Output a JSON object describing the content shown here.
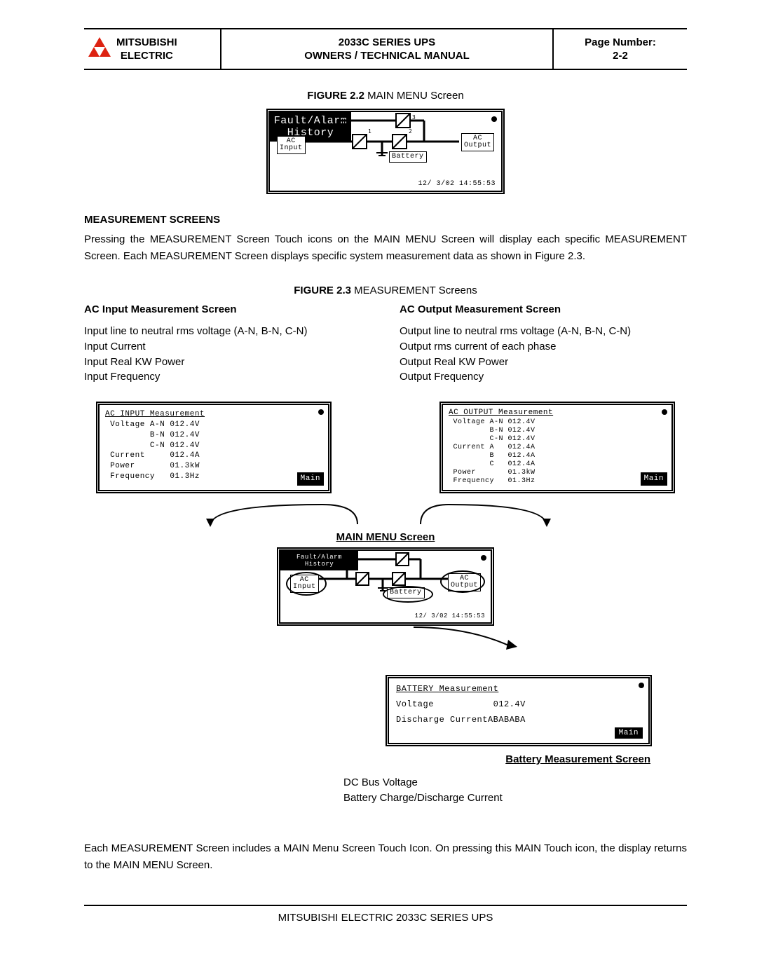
{
  "header": {
    "brand1": "MITSUBISHI",
    "brand2": "ELECTRIC",
    "title1": "2033C SERIES UPS",
    "title2": "OWNERS / TECHNICAL MANUAL",
    "page_label": "Page Number:",
    "page_num": "2-2"
  },
  "fig22": {
    "num": "FIGURE 2.2",
    "name": " MAIN MENU Screen",
    "ac_input": "AC\nInput",
    "ac_output": "AC\nOutput",
    "battery": "Battery",
    "fault": "Fault/Alarm\nHistory",
    "date": "12/ 3/02 14:55:53"
  },
  "section": {
    "title": "MEASUREMENT SCREENS",
    "p1": "Pressing the MEASUREMENT Screen Touch icons on the MAIN MENU Screen will display each specific MEASUREMENT Screen. Each MEASUREMENT Screen displays specific system measurement data as shown in Figure 2.3."
  },
  "fig23": {
    "num": "FIGURE 2.3",
    "name": " MEASUREMENT Screens"
  },
  "ac_input_col": {
    "title": "AC Input Measurement Screen",
    "l1": "Input line to neutral rms voltage (A-N, B-N, C-N)",
    "l2": "Input Current",
    "l3": "Input Real KW Power",
    "l4": "Input Frequency"
  },
  "ac_output_col": {
    "title": "AC Output Measurement Screen",
    "l1": "Output line to neutral rms voltage (A-N, B-N, C-N)",
    "l2": "Output rms current of each phase",
    "l3": "Output Real KW Power",
    "l4": "Output Frequency"
  },
  "lcd_ac_input": {
    "title": "AC INPUT Measurement",
    "lines": " Voltage A-N 012.4V\n         B-N 012.4V\n         C-N 012.4V\n Current     012.4A\n Power       01.3kW\n Frequency   01.3Hz",
    "main": "Main"
  },
  "lcd_ac_output": {
    "title": "AC OUTPUT Measurement",
    "lines": " Voltage A-N 012.4V\n         B-N 012.4V\n         C-N 012.4V\n Current A   012.4A\n         B   012.4A\n         C   012.4A\n Power       01.3kW\n Frequency   01.3Hz",
    "main": "Main"
  },
  "mainmenu_label": "MAIN MENU Screen",
  "lcd_battery": {
    "title": "BATTERY Measurement",
    "l1": "Voltage           012.4V",
    "l2": "Discharge CurrentABABABA",
    "main": "Main"
  },
  "battery_label": "Battery Measurement Screen",
  "battery_list": {
    "l1": "DC Bus Voltage",
    "l2": "Battery Charge/Discharge Current"
  },
  "closing_p": "Each MEASUREMENT Screen includes a MAIN Menu Screen Touch Icon. On pressing this MAIN Touch icon, the display returns to the MAIN MENU Screen.",
  "footer": "MITSUBISHI ELECTRIC 2033C SERIES UPS"
}
